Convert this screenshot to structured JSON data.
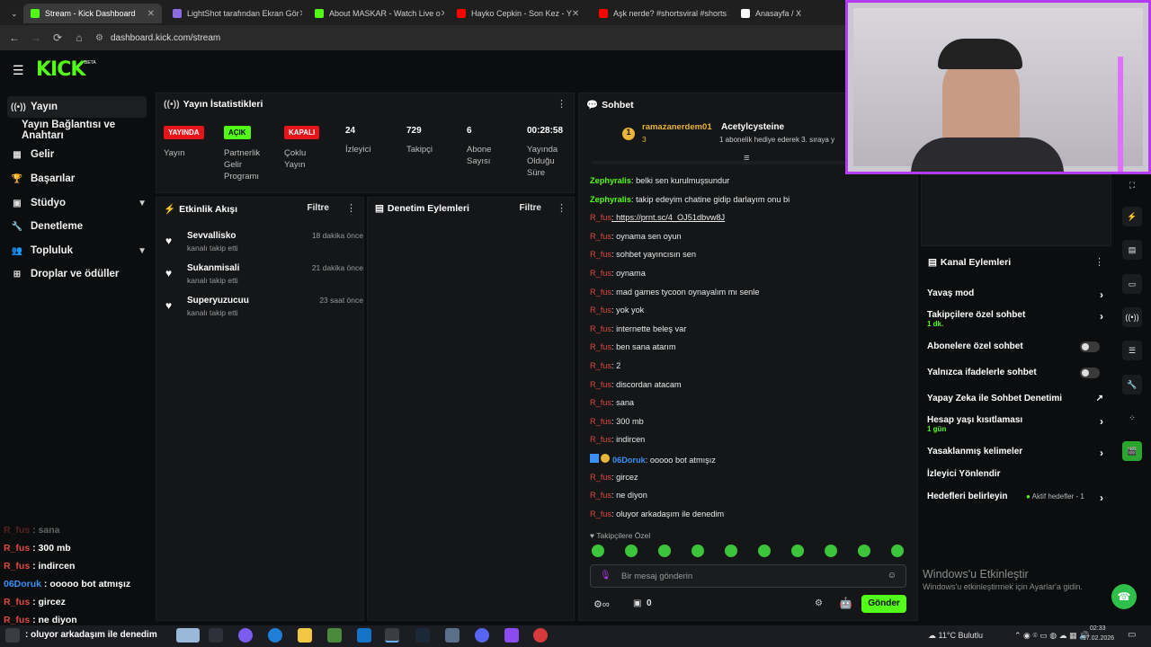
{
  "browser": {
    "tabs": [
      {
        "title": "Stream - Kick Dashboard",
        "color": "#53fc18"
      },
      {
        "title": "LightShot tarafından Ekran Gör",
        "color": "#8a6be0"
      },
      {
        "title": "About MASKAR - Watch Live o",
        "color": "#53fc18"
      },
      {
        "title": "Hayko Cepkin - Son Kez - Y",
        "color": "#ff0000"
      },
      {
        "title": "Aşk nerde? #shortsviral #shorts",
        "color": "#ff0000"
      },
      {
        "title": "Anasayfa / X",
        "color": "#ffffff"
      }
    ],
    "url": "dashboard.kick.com/stream"
  },
  "logo": "KICK",
  "logo_tag": "BETA",
  "sidebar": {
    "items": [
      {
        "label": "Yayın",
        "icon": "broadcast-icon"
      },
      {
        "label": "Yayın Bağlantısı ve Anahtarı",
        "icon": ""
      },
      {
        "label": "Gelir",
        "icon": "money-icon"
      },
      {
        "label": "Başarılar",
        "icon": "trophy-icon"
      },
      {
        "label": "Stüdyo",
        "icon": "studio-icon"
      },
      {
        "label": "Denetleme",
        "icon": "wrench-icon"
      },
      {
        "label": "Topluluk",
        "icon": "community-icon"
      },
      {
        "label": "Droplar ve ödüller",
        "icon": "drops-icon"
      }
    ]
  },
  "stats": {
    "title": "Yayın İstatistikleri",
    "items": [
      {
        "badge": "YAYINDA",
        "label": "Yayın",
        "badge_color": "#e5141a"
      },
      {
        "badge": "AÇIK",
        "label": "Partnerlik Gelir Programı",
        "badge_color": "#53fc18"
      },
      {
        "badge": "KAPALI",
        "label": "Çoklu Yayın",
        "badge_color": "#e5141a"
      },
      {
        "value": "24",
        "label": "İzleyici"
      },
      {
        "value": "729",
        "label": "Takipçi"
      },
      {
        "value": "6",
        "label": "Abone Sayısı"
      },
      {
        "value": "00:28:58",
        "label": "Yayında Olduğu Süre"
      }
    ]
  },
  "activity": {
    "title": "Etkinlik Akışı",
    "filter": "Filtre",
    "items": [
      {
        "name": "Sevvallisko",
        "sub": "kanalı takip etti",
        "time": "18 dakika önce"
      },
      {
        "name": "Sukanmisali",
        "sub": "kanalı takip etti",
        "time": "21 dakika önce"
      },
      {
        "name": "Superyuzucuu",
        "sub": "kanalı takip etti",
        "time": "23 saat önce"
      }
    ]
  },
  "moderation": {
    "title": "Denetim Eylemleri",
    "filter": "Filtre"
  },
  "chat": {
    "title": "Sohbet",
    "pinned": {
      "user": "ramazanerdem01",
      "count": "3",
      "target": "Acetylcysteine",
      "text": "1 abonelik hediye ederek 3. sıraya y"
    },
    "messages": [
      {
        "user": "Zephyralis",
        "text": ": belki sen kurulmuşsundur",
        "cls": "u-g"
      },
      {
        "user": "Zephyralis",
        "text": ": takip edeyim chatine gidip darlayım onu bi",
        "cls": "u-g"
      },
      {
        "user": "R_fus",
        "text": ": https://prnt.sc/4_OJ51dbvw8J",
        "cls": "u-r"
      },
      {
        "user": "R_fus",
        "text": ": oynama sen oyun",
        "cls": "u-r"
      },
      {
        "user": "R_fus",
        "text": ": sohbet yayıncısın sen",
        "cls": "u-r"
      },
      {
        "user": "R_fus",
        "text": ": oynama",
        "cls": "u-r"
      },
      {
        "user": "R_fus",
        "text": ": mad games tycoon oynayalım mı senle",
        "cls": "u-r"
      },
      {
        "user": "R_fus",
        "text": ": yok yok",
        "cls": "u-r"
      },
      {
        "user": "R_fus",
        "text": ": internette beleş var",
        "cls": "u-r"
      },
      {
        "user": "R_fus",
        "text": ": ben sana atarım",
        "cls": "u-r"
      },
      {
        "user": "R_fus",
        "text": ": 2",
        "cls": "u-r"
      },
      {
        "user": "R_fus",
        "text": ": discordan atacam",
        "cls": "u-r"
      },
      {
        "user": "R_fus",
        "text": ": sana",
        "cls": "u-r"
      },
      {
        "user": "R_fus",
        "text": ": 300 mb",
        "cls": "u-r"
      },
      {
        "user": "R_fus",
        "text": ": indircen",
        "cls": "u-r"
      },
      {
        "user": "06Doruk",
        "text": ": ooooo bot atmışız",
        "cls": "u-b"
      },
      {
        "user": "R_fus",
        "text": ": gircez",
        "cls": "u-r"
      },
      {
        "user": "R_fus",
        "text": ": ne diyon",
        "cls": "u-r"
      },
      {
        "user": "R_fus",
        "text": ": oluyor arkadaşım ile denedim",
        "cls": "u-r"
      }
    ],
    "followers_only": "Takipçilere Özel",
    "placeholder": "Bir mesaj gönderin",
    "count": "0",
    "send": "Gönder"
  },
  "channel_actions": {
    "title": "Kanal Eylemleri",
    "items": [
      {
        "label": "Yavaş mod",
        "sub": "",
        "control": "arrow"
      },
      {
        "label": "Takipçilere özel sohbet",
        "sub": "1 dk.",
        "control": "arrow"
      },
      {
        "label": "Abonelere özel sohbet",
        "sub": "",
        "control": "toggle"
      },
      {
        "label": "Yalnızca ifadelerle sohbet",
        "sub": "",
        "control": "toggle"
      },
      {
        "label": "Yapay Zeka ile Sohbet Denetimi",
        "sub": "",
        "control": "external"
      },
      {
        "label": "Hesap yaşı kısıtlaması",
        "sub": "1 gün",
        "control": "arrow"
      },
      {
        "label": "Yasaklanmış kelimeler",
        "sub": "",
        "control": "arrow"
      },
      {
        "label": "İzleyici Yönlendir",
        "sub": "",
        "control": ""
      },
      {
        "label": "Hedefleri belirleyin",
        "sub": "",
        "control": "arrow",
        "extra": "Aktif hedefler - 1"
      }
    ]
  },
  "overlay_chat": [
    {
      "user": "R_fus",
      "text": " : sana"
    },
    {
      "user": "R_fus",
      "text": " : 300 mb"
    },
    {
      "user": "R_fus",
      "text": " : indircen"
    },
    {
      "user": "06Doruk",
      "text": " : ooooo bot atmışız"
    },
    {
      "user": "R_fus",
      "text": " : gircez"
    },
    {
      "user": "R_fus",
      "text": " : ne diyon"
    },
    {
      "user": "",
      "text": ": oluyor arkadaşım ile denedim"
    }
  ],
  "windows_watermark": {
    "title": "Windows'u Etkinleştir",
    "sub": "Windows'u etkinleştirmek için Ayarlar'a gidin."
  },
  "taskbar": {
    "weather": "11°C  Bulutlu",
    "time": "02:33",
    "date": "17.02.2026"
  }
}
